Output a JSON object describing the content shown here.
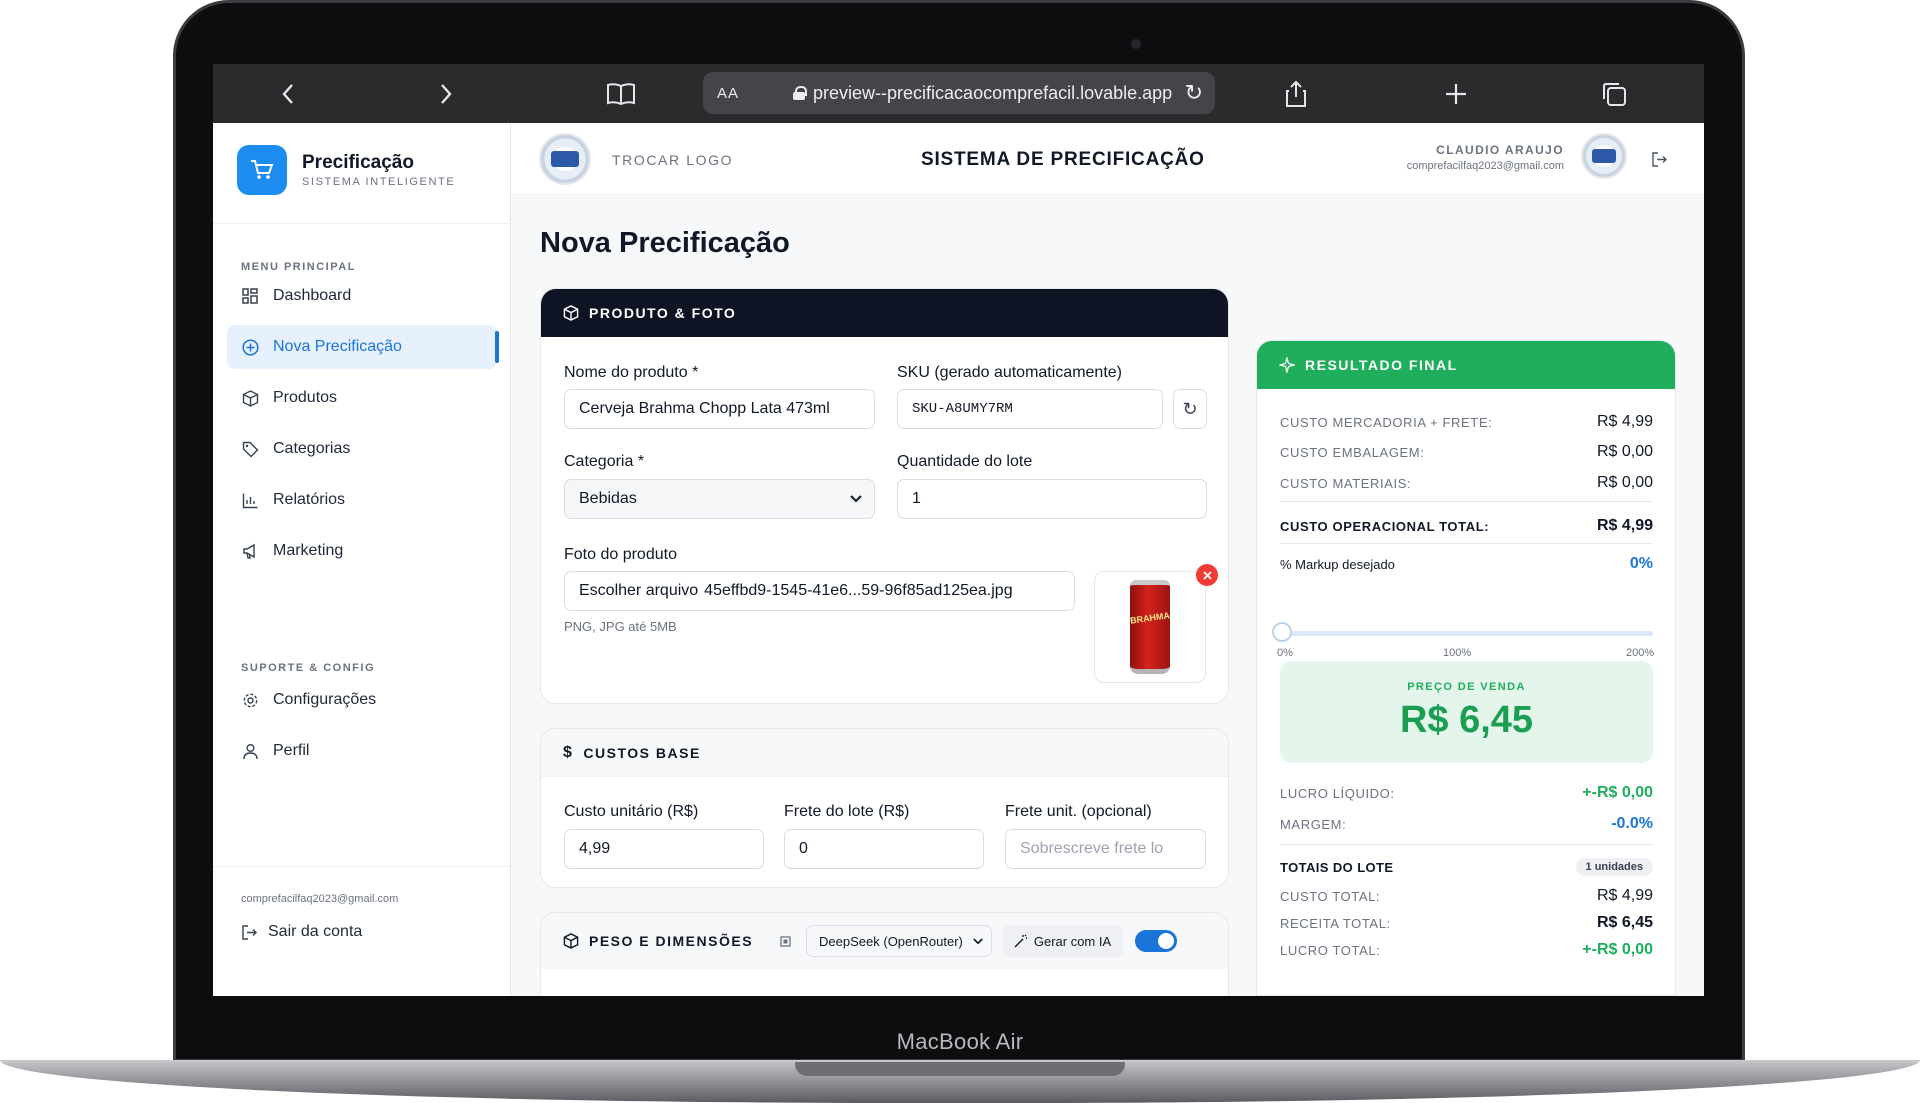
{
  "device": {
    "label": "MacBook Air"
  },
  "browser": {
    "aa_label": "AA",
    "url": "preview--precificacaocomprefacil.lovable.app"
  },
  "sidebar": {
    "title": "Precificação",
    "subtitle": "SISTEMA INTELIGENTE",
    "menu_heading": "MENU PRINCIPAL",
    "items": [
      {
        "label": "Dashboard",
        "icon": "grid-icon"
      },
      {
        "label": "Nova Precificação",
        "icon": "plus-circle-icon",
        "active": true
      },
      {
        "label": "Produtos",
        "icon": "box-icon"
      },
      {
        "label": "Categorias",
        "icon": "tag-icon"
      },
      {
        "label": "Relatórios",
        "icon": "bar-chart-icon"
      },
      {
        "label": "Marketing",
        "icon": "megaphone-icon"
      }
    ],
    "support_heading": "SUPORTE & CONFIG",
    "support_items": [
      {
        "label": "Configurações",
        "icon": "gear-icon"
      },
      {
        "label": "Perfil",
        "icon": "user-icon"
      }
    ],
    "footer_email": "comprefacilfaq2023@gmail.com",
    "logout_label": "Sair da conta"
  },
  "header": {
    "change_logo_label": "TROCAR LOGO",
    "title": "SISTEMA DE PRECIFICAÇÃO",
    "user_name": "CLAUDIO ARAUJO",
    "user_email": "comprefacilfaq2023@gmail.com"
  },
  "page": {
    "title": "Nova Precificação"
  },
  "product_card": {
    "heading": "PRODUTO & FOTO",
    "name_label": "Nome do produto *",
    "name_value": "Cerveja Brahma Chopp Lata 473ml",
    "sku_label": "SKU (gerado automaticamente)",
    "sku_value": "SKU-A8UMY7RM",
    "category_label": "Categoria *",
    "category_value": "Bebidas",
    "qty_label": "Quantidade do lote",
    "qty_value": "1",
    "photo_label": "Foto do produto",
    "file_button": "Escolher arquivo",
    "file_name": "45effbd9-1545-41e6...59-96f85ad125ea.jpg",
    "photo_hint": "PNG, JPG até 5MB",
    "can_text": "BRAHMA"
  },
  "costs_card": {
    "heading": "CUSTOS BASE",
    "unit_cost_label": "Custo unitário (R$)",
    "unit_cost_value": "4,99",
    "lot_freight_label": "Frete do lote (R$)",
    "lot_freight_value": "0",
    "unit_freight_label": "Frete unit. (opcional)",
    "unit_freight_placeholder": "Sobrescreve frete lo"
  },
  "weight_card": {
    "heading": "PESO E DIMENSÕES",
    "model_value": "DeepSeek (OpenRouter)",
    "ai_button": "Gerar com IA",
    "toggle_on": true
  },
  "result": {
    "heading": "RESULTADO FINAL",
    "goods_freight_label": "CUSTO MERCADORIA + FRETE:",
    "goods_freight_value": "R$ 4,99",
    "packaging_label": "CUSTO EMBALAGEM:",
    "packaging_value": "R$ 0,00",
    "materials_label": "CUSTO MATERIAIS:",
    "materials_value": "R$ 0,00",
    "operational_label": "CUSTO OPERACIONAL TOTAL:",
    "operational_value": "R$ 4,99",
    "markup_label": "% Markup desejado",
    "markup_value": "0%",
    "markup_fraction": 0,
    "tick_0": "0%",
    "tick_100": "100%",
    "tick_200": "200%",
    "price_label": "PREÇO DE VENDA",
    "price_value": "R$ 6,45",
    "net_profit_label": "LUCRO LÍQUIDO:",
    "net_profit_value": "+-R$ 0,00",
    "margin_label": "MARGEM:",
    "margin_value": "-0.0%",
    "lot_totals_label": "TOTAIS DO LOTE",
    "lot_units_badge": "1 unidades",
    "total_cost_label": "CUSTO TOTAL:",
    "total_cost_value": "R$ 4,99",
    "total_revenue_label": "RECEITA TOTAL:",
    "total_revenue_value": "R$ 6,45",
    "total_profit_label": "LUCRO TOTAL:",
    "total_profit_value": "+-R$ 0,00"
  },
  "colors": {
    "accent": "#1d8cf0",
    "success": "#1fae5b",
    "dark_header": "#0e1423"
  }
}
